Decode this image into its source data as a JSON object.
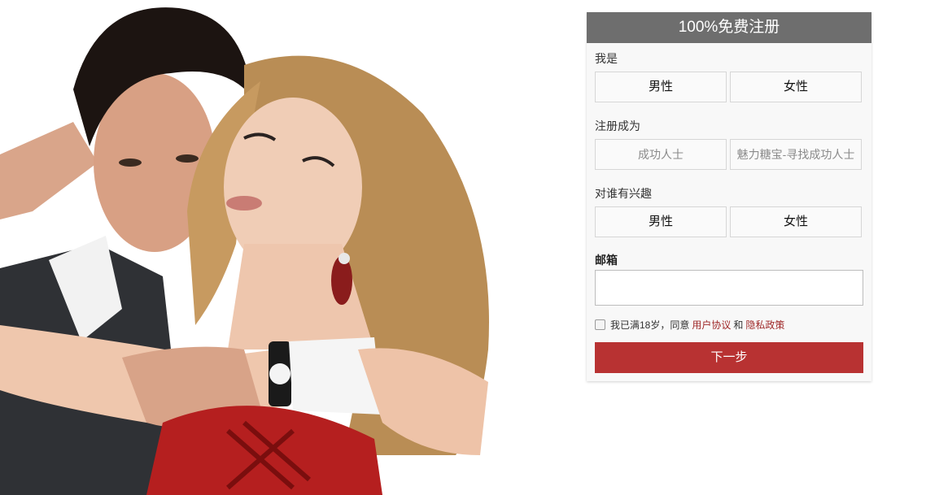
{
  "form": {
    "header": "100%免费注册",
    "iam": {
      "label": "我是",
      "options": [
        "男性",
        "女性"
      ]
    },
    "register_as": {
      "label": "注册成为",
      "options": [
        "成功人士",
        "魅力糖宝-寻找成功人士"
      ]
    },
    "interested_in": {
      "label": "对谁有兴趣",
      "options": [
        "男性",
        "女性"
      ]
    },
    "email": {
      "label": "邮箱",
      "value": ""
    },
    "agreement": {
      "prefix": "我已满18岁，同意",
      "user_agreement": "用户协议",
      "and": "和",
      "privacy_policy": "隐私政策"
    },
    "next_button": "下一步"
  },
  "colors": {
    "header_bg": "#6e6e6e",
    "accent_red": "#b83232",
    "link_red": "#a02a2a"
  }
}
